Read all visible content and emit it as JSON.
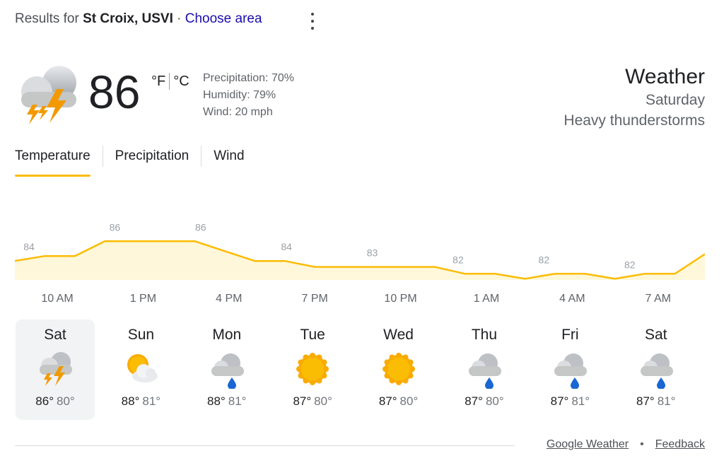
{
  "results": {
    "prefix": "Results for",
    "location": "St Croix, USVI",
    "separator": "·",
    "choose_area": "Choose area",
    "menu_icon": "more-vert-icon"
  },
  "current": {
    "icon": "thunderstorm-icon",
    "temp": "86",
    "unit_f": "°F",
    "unit_c": "°C",
    "precipitation": "Precipitation: 70%",
    "humidity": "Humidity: 79%",
    "wind": "Wind: 20 mph"
  },
  "header": {
    "title": "Weather",
    "day": "Saturday",
    "condition": "Heavy thunderstorms"
  },
  "tabs": [
    {
      "label": "Temperature",
      "active": true
    },
    {
      "label": "Precipitation"
    },
    {
      "label": "Wind"
    }
  ],
  "chart_data": {
    "type": "area",
    "labels": [
      "84",
      "86",
      "86",
      "84",
      "83",
      "82",
      "82",
      "82"
    ],
    "x": [
      "10 AM",
      "1 PM",
      "4 PM",
      "7 PM",
      "10 PM",
      "1 AM",
      "4 AM",
      "7 AM"
    ],
    "values": [
      84,
      84.5,
      84.5,
      86,
      86,
      86,
      86,
      85,
      84,
      84,
      83.4,
      83.4,
      83.4,
      83.4,
      83.4,
      82.7,
      82.7,
      82.2,
      82.7,
      82.7,
      82.2,
      82.7,
      82.7,
      84.7
    ],
    "color": "#fbbc04",
    "fill": "#fef7d9",
    "ylim": [
      80,
      88
    ]
  },
  "days": [
    {
      "name": "Sat",
      "icon": "thunderstorm-icon",
      "hi": "86°",
      "lo": "80°",
      "selected": true
    },
    {
      "name": "Sun",
      "icon": "partly-cloudy-icon",
      "hi": "88°",
      "lo": "81°"
    },
    {
      "name": "Mon",
      "icon": "showers-icon",
      "hi": "88°",
      "lo": "81°"
    },
    {
      "name": "Tue",
      "icon": "sunny-icon",
      "hi": "87°",
      "lo": "80°"
    },
    {
      "name": "Wed",
      "icon": "sunny-icon",
      "hi": "87°",
      "lo": "80°"
    },
    {
      "name": "Thu",
      "icon": "showers-icon",
      "hi": "87°",
      "lo": "80°"
    },
    {
      "name": "Fri",
      "icon": "showers-icon",
      "hi": "87°",
      "lo": "81°"
    },
    {
      "name": "Sat",
      "icon": "showers-icon",
      "hi": "87°",
      "lo": "81°"
    }
  ],
  "footer": {
    "google_weather": "Google Weather",
    "dot": "•",
    "feedback": "Feedback"
  }
}
